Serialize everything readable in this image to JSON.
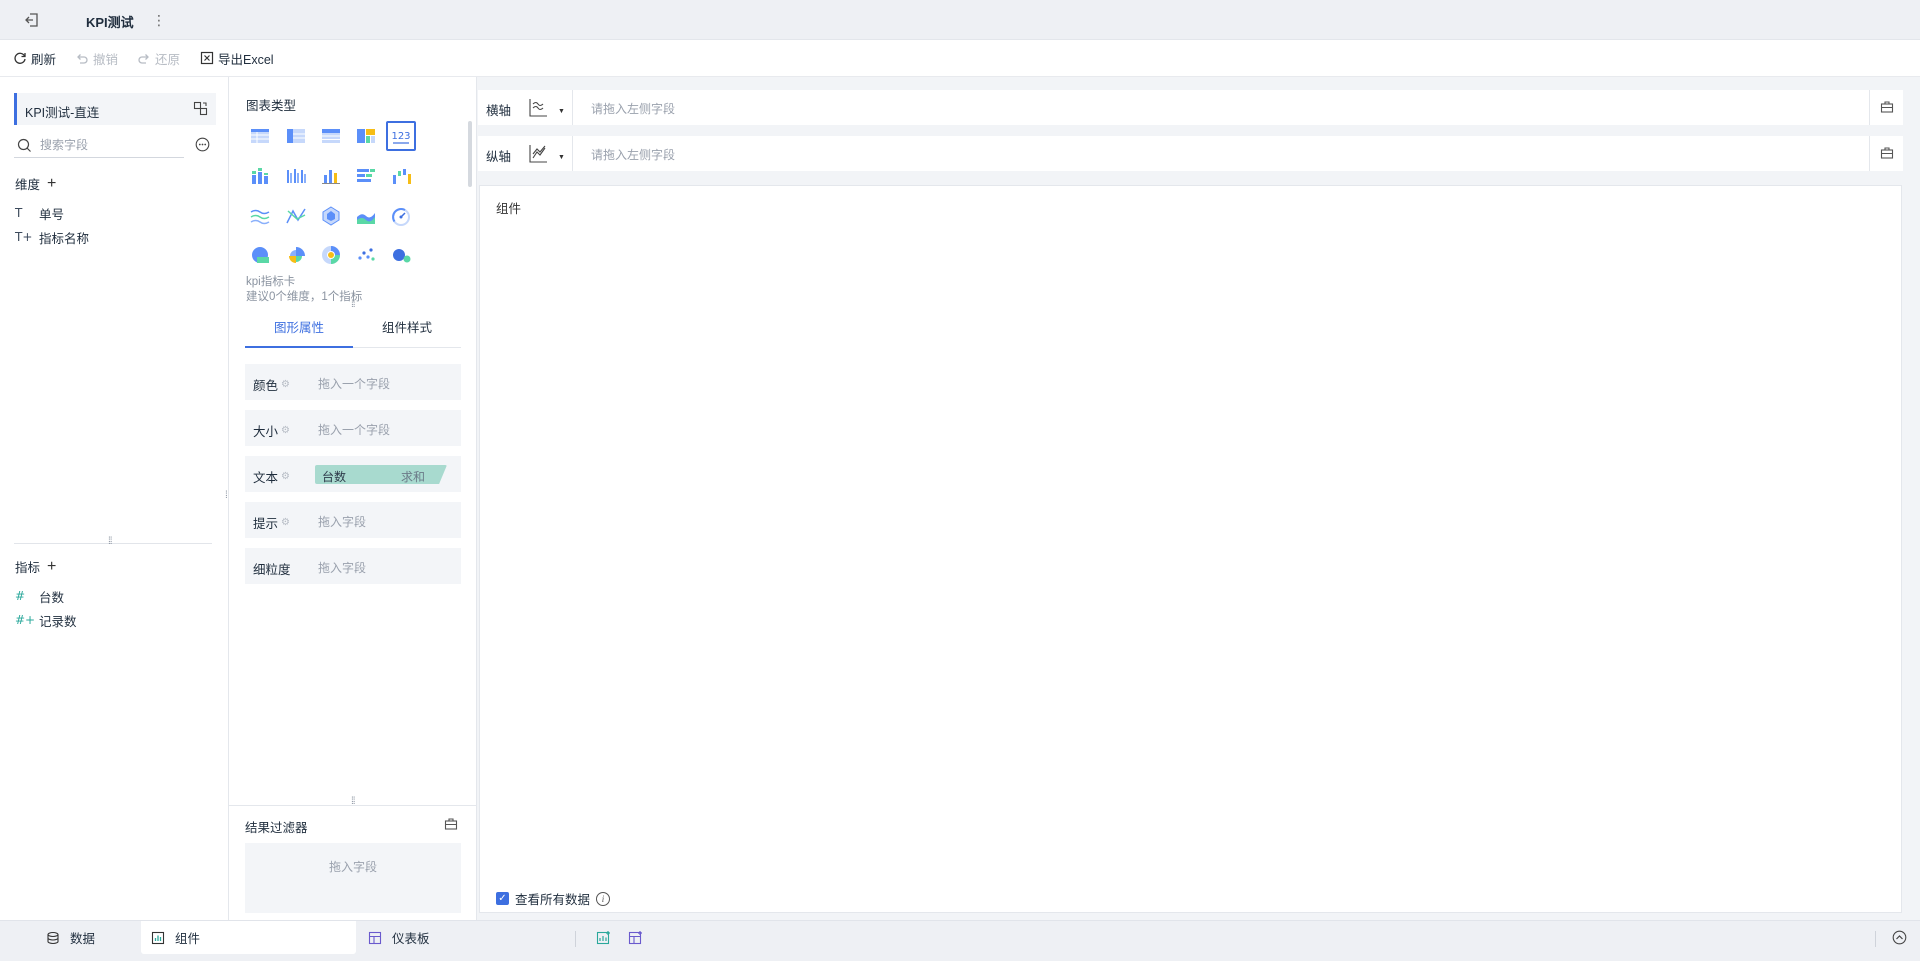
{
  "titlebar": {
    "back_icon": "exit-icon",
    "title": "KPI测试",
    "more_icon": "vertical-dots-icon"
  },
  "toolbar": {
    "refresh": "刷新",
    "undo": "撤销",
    "redo": "还原",
    "export": "导出Excel"
  },
  "left_panel": {
    "datasource": "KPI测试-直连",
    "search_placeholder": "搜索字段",
    "dimensions_title": "维度",
    "dimensions": [
      {
        "label": "单号",
        "icon": "T"
      },
      {
        "label": "指标名称",
        "icon": "T+"
      }
    ],
    "measures_title": "指标",
    "measures": [
      {
        "label": "台数",
        "icon": "#"
      },
      {
        "label": "记录数",
        "icon": "#+"
      }
    ]
  },
  "middle_panel": {
    "chart_types_title": "图表类型",
    "chart_type_icons": [
      "table-icon",
      "pivot-table-icon",
      "detail-table-icon",
      "treemap-icon",
      "kpi-card-icon",
      "stacked-column-icon",
      "grouped-column-icon",
      "column-chart-icon",
      "bar-chart-icon",
      "waterfall-icon",
      "line-chart-icon",
      "combo-chart-icon",
      "radar-icon",
      "area-chart-icon",
      "gauge-icon",
      "pie-chart-icon",
      "rose-chart-icon",
      "sunburst-icon",
      "scatter-icon",
      "bubble-icon"
    ],
    "selected_chart": "kpi-card-icon",
    "kpi_card_text": "123",
    "chart_desc_name": "kpi指标卡",
    "chart_desc_hint": "建议0个维度，1个指标",
    "tabs": [
      "图形属性",
      "组件样式"
    ],
    "active_tab": 0,
    "properties": [
      {
        "label": "颜色",
        "drop": "拖入一个字段"
      },
      {
        "label": "大小",
        "drop": "拖入一个字段"
      },
      {
        "label": "文本",
        "pill_left": "台数",
        "pill_right": "求和"
      },
      {
        "label": "提示",
        "drop": "拖入字段"
      },
      {
        "label": "细粒度",
        "drop": "拖入字段"
      }
    ],
    "result_filter_title": "结果过滤器",
    "result_filter_drop": "拖入字段"
  },
  "right_area": {
    "x_axis": {
      "label": "横轴",
      "placeholder": "请拖入左侧字段"
    },
    "y_axis": {
      "label": "纵轴",
      "placeholder": "请拖入左侧字段"
    },
    "component_name": "组件",
    "view_all_label": "查看所有数据",
    "view_all_checked": true
  },
  "bottom_bar": {
    "tabs": [
      "数据",
      "组件",
      "仪表板"
    ],
    "active_tab": 1
  },
  "colors": {
    "accent": "#3d6fe0",
    "measure": "#2aa89b",
    "pill": "#a8dacf",
    "chart_blue": "#5b8ff9",
    "chart_green": "#5ad8a6",
    "chart_yellow": "#f6bd16"
  }
}
